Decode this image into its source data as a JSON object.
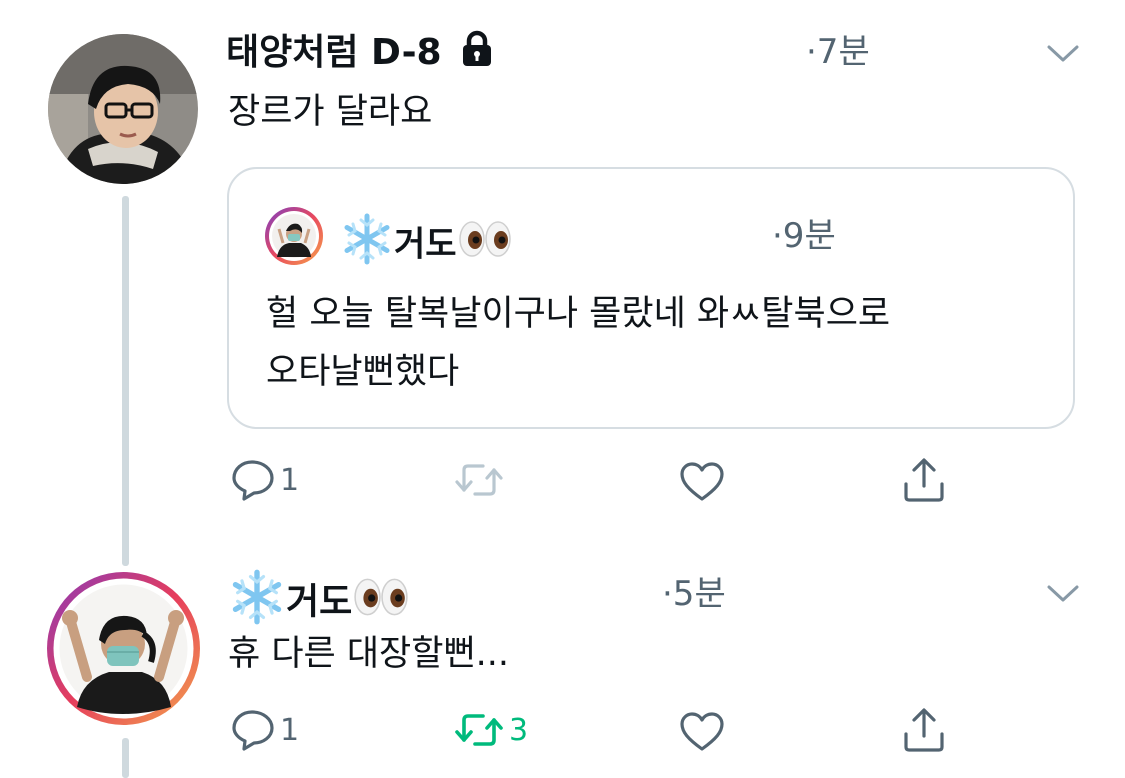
{
  "tweets": [
    {
      "name": "태양처럼 D-8",
      "locked": true,
      "time": "·7분",
      "text": "장르가 달라요",
      "quote": {
        "name": "거도",
        "time": "·9분",
        "text_line1": "헐 오늘 탈복날이구나 몰랐네 와ㅆ탈북으로",
        "text_line2": "오타날뻔했다"
      },
      "actions": {
        "reply_count": "1",
        "retweet_count": "",
        "like_count": ""
      }
    },
    {
      "name": "거도",
      "time": "·5분",
      "text": "휴 다른 대장할뻔...",
      "actions": {
        "reply_count": "1",
        "retweet_count": "3",
        "like_count": ""
      }
    }
  ],
  "icons": {
    "lock": "lock-icon",
    "snowflake": "snowflake-emoji",
    "eyes": "eyes-emoji",
    "chevron": "chevron-down-icon",
    "reply": "reply-icon",
    "retweet": "retweet-icon",
    "like": "heart-icon",
    "share": "share-icon"
  },
  "colors": {
    "text": "#0f1419",
    "muted": "#536471",
    "retweet_active": "#00ba7c",
    "thread_line": "#cfd9de",
    "border": "#d6dde2"
  }
}
